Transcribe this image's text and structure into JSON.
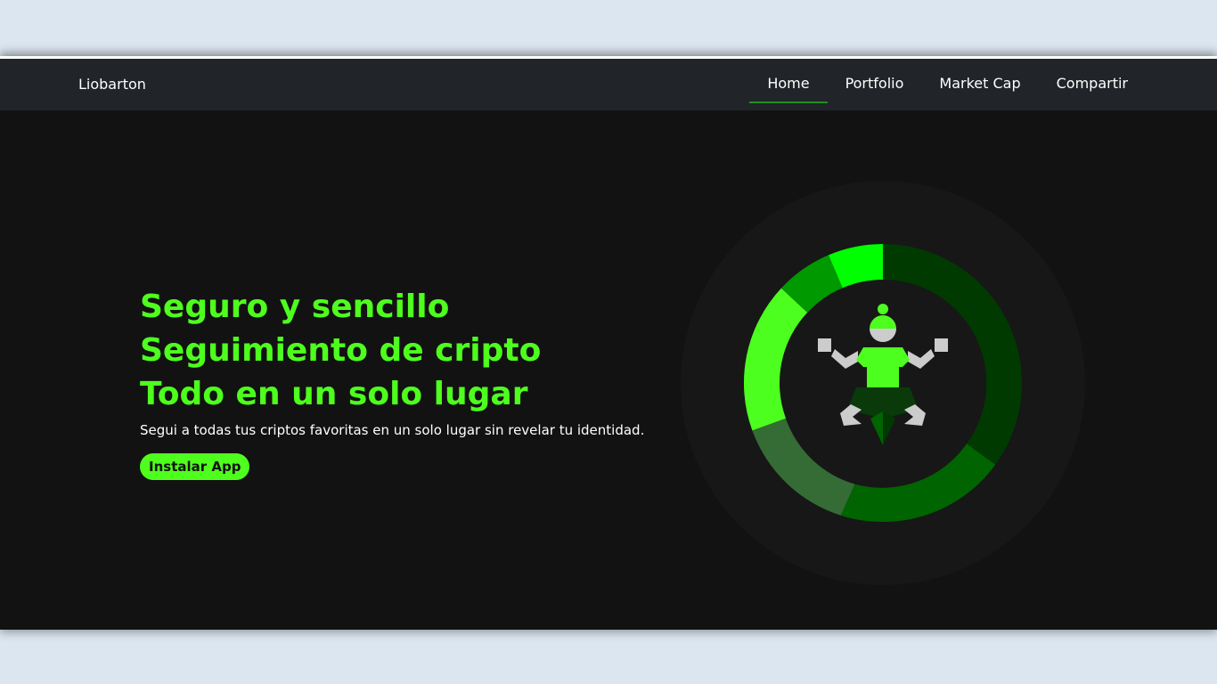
{
  "navbar": {
    "brand": "Liobarton",
    "links": [
      {
        "label": "Home",
        "active": true
      },
      {
        "label": "Portfolio",
        "active": false
      },
      {
        "label": "Market Cap",
        "active": false
      },
      {
        "label": "Compartir",
        "active": false
      }
    ]
  },
  "hero": {
    "headline": [
      "Seguro y sencillo",
      "Seguimiento de cripto",
      "Todo en un solo lugar"
    ],
    "subtitle": "Segui a todas tus criptos favoritas en un solo lugar sin revelar tu identidad.",
    "cta_label": "Instalar App"
  },
  "illustration": {
    "icon": "meditating-person-ring-icon",
    "colors": {
      "accent": "#4eff1e",
      "ring_segments": [
        "#003a00",
        "#006400",
        "#356b35",
        "#4dff1f",
        "#009900",
        "#00ff00"
      ],
      "background": "#121212"
    }
  }
}
